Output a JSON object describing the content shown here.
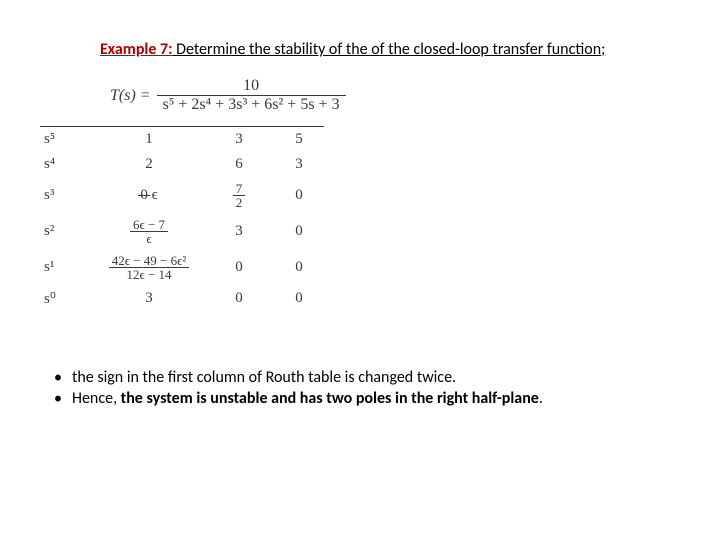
{
  "title": {
    "prefix": "Example 7:",
    "rest": " Determine the stability of the of the closed-loop transfer function;"
  },
  "eq": {
    "lhs": "T(s) = ",
    "num": "10",
    "den": "s⁵ + 2s⁴ + 3s³ + 6s² + 5s + 3"
  },
  "table": {
    "rows": [
      {
        "lab": "s⁵",
        "c1": "1",
        "c2": "3",
        "c3": "5"
      },
      {
        "lab": "s⁴",
        "c1": "2",
        "c2": "6",
        "c3": "3"
      },
      {
        "lab": "s³",
        "c1_strike": "0",
        "c1_after": " ϵ",
        "c2_frac": {
          "t": "7",
          "b": "2"
        },
        "c3": "0"
      },
      {
        "lab": "s²",
        "c1_frac": {
          "t": "6ϵ − 7",
          "b": "ϵ"
        },
        "c2": "3",
        "c3": "0"
      },
      {
        "lab": "s¹",
        "c1_frac": {
          "t": "42ϵ − 49 − 6ϵ²",
          "b": "12ϵ − 14"
        },
        "c2": "0",
        "c3": "0"
      },
      {
        "lab": "s⁰",
        "c1": "3",
        "c2": "0",
        "c3": "0"
      }
    ]
  },
  "bullets": [
    {
      "text": "the sign in the first column of Routh table is changed twice."
    },
    {
      "lead": "Hence, ",
      "bold": "the system is unstable and has two poles in the right half-plane",
      "tail": "."
    }
  ]
}
